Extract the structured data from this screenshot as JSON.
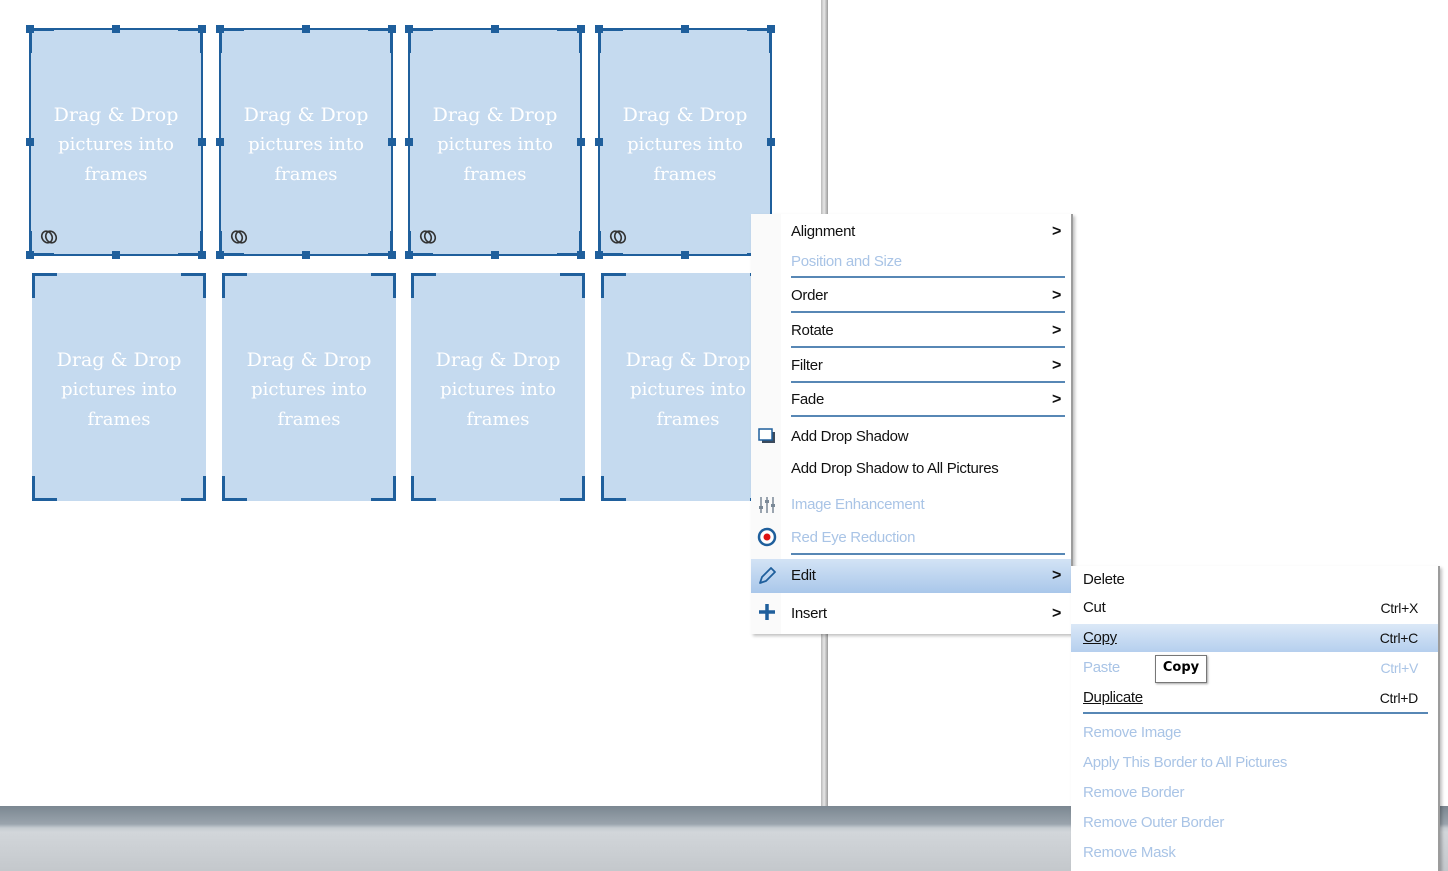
{
  "frames": {
    "placeholder_line1": "Drag & Drop",
    "placeholder_line2": "pictures into",
    "placeholder_line3": "frames",
    "link_icon": "link-icon",
    "selected_rows": 1,
    "unselected_rows": 1
  },
  "context_menu": {
    "items": [
      {
        "label": "Alignment",
        "submenu": true,
        "enabled": true
      },
      {
        "label": "Position and Size",
        "submenu": false,
        "enabled": false
      },
      {
        "label": "Order",
        "submenu": true,
        "enabled": true
      },
      {
        "label": "Rotate",
        "submenu": true,
        "enabled": true
      },
      {
        "label": "Filter",
        "submenu": true,
        "enabled": true
      },
      {
        "label": "Fade",
        "submenu": true,
        "enabled": true
      },
      {
        "label": "Add Drop Shadow",
        "icon": "drop-shadow-icon",
        "enabled": true
      },
      {
        "label": "Add Drop Shadow to All Pictures",
        "enabled": true
      },
      {
        "label": "Image Enhancement",
        "icon": "sliders-icon",
        "enabled": false
      },
      {
        "label": "Red Eye Reduction",
        "icon": "eye-icon",
        "enabled": false
      },
      {
        "label": "Edit",
        "icon": "pencil-icon",
        "submenu": true,
        "enabled": true,
        "active": true
      },
      {
        "label": "Insert",
        "icon": "plus-icon",
        "submenu": true,
        "enabled": true
      }
    ]
  },
  "edit_submenu": {
    "items": [
      {
        "label": "Delete",
        "shortcut": "",
        "enabled": true
      },
      {
        "label": "Cut",
        "shortcut": "Ctrl+X",
        "enabled": true
      },
      {
        "label": "Copy",
        "shortcut": "Ctrl+C",
        "enabled": true,
        "highlighted": true
      },
      {
        "label": "Paste",
        "shortcut": "Ctrl+V",
        "enabled": false
      },
      {
        "label": "Duplicate",
        "shortcut": "Ctrl+D",
        "enabled": true
      },
      {
        "label": "Remove Image",
        "enabled": false
      },
      {
        "label": "Apply This Border to All Pictures",
        "enabled": false
      },
      {
        "label": "Remove Border",
        "enabled": false
      },
      {
        "label": "Remove Outer Border",
        "enabled": false
      },
      {
        "label": "Remove Mask",
        "enabled": false
      }
    ]
  },
  "tooltip": "Copy",
  "arrow_glyph": ">",
  "colors": {
    "frame_fill": "#c5daef",
    "selection": "#1f5f9c",
    "disabled_text": "#a9c4e6",
    "highlight": "#b5cfee"
  }
}
